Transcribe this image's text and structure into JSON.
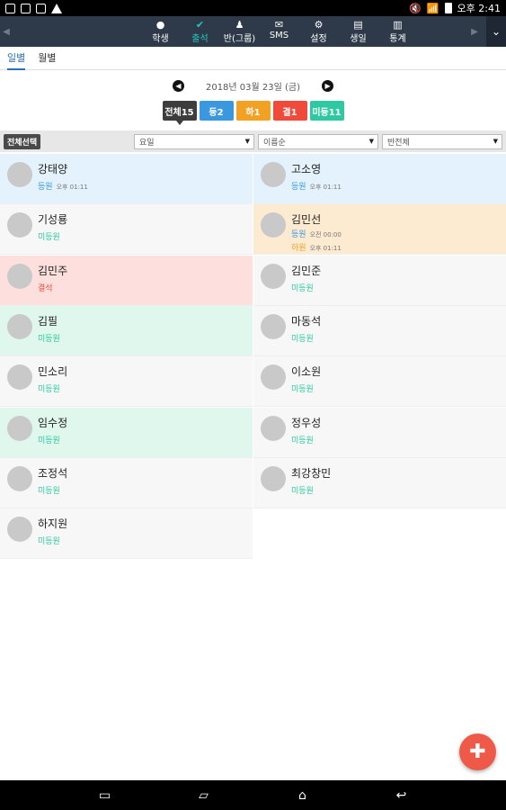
{
  "status_bar": {
    "time": "오후 2:41",
    "left_icons": [
      "image-icon",
      "wifi-calling-icon",
      "gallery-icon",
      "warning-icon"
    ],
    "right_icons": [
      "mute-icon",
      "wifi-icon",
      "battery-icon"
    ]
  },
  "top_nav": {
    "items": [
      {
        "label": "학생",
        "icon": "person-icon",
        "active": false
      },
      {
        "label": "출석",
        "icon": "check-circle-icon",
        "active": true
      },
      {
        "label": "반(그룹)",
        "icon": "group-icon",
        "active": false
      },
      {
        "label": "SMS",
        "icon": "mail-icon",
        "active": false
      },
      {
        "label": "설정",
        "icon": "gear-icon",
        "active": false
      },
      {
        "label": "생일",
        "icon": "cake-icon",
        "active": false
      },
      {
        "label": "통계",
        "icon": "chart-icon",
        "active": false
      }
    ]
  },
  "subtabs": [
    {
      "label": "일별",
      "active": true
    },
    {
      "label": "월별",
      "active": false
    }
  ],
  "date": {
    "text": "2018년 03월 23일 (금)"
  },
  "filters": {
    "all": "전체15",
    "in": "등2",
    "out": "하1",
    "absent": "결1",
    "none": "미등11"
  },
  "toolbar": {
    "select_all": "전체선택",
    "day_select": "요일",
    "sort_select": "이름순",
    "class_select": "반전체"
  },
  "students": [
    {
      "name": "강태양",
      "status1": "등원",
      "time1": "오후 01:11",
      "status2": "",
      "time2": "",
      "bg": "blue"
    },
    {
      "name": "고소영",
      "status1": "등원",
      "time1": "오후 01:11",
      "status2": "",
      "time2": "",
      "bg": "blue"
    },
    {
      "name": "기성룡",
      "status1": "미등원",
      "time1": "",
      "status2": "",
      "time2": "",
      "bg": "gray"
    },
    {
      "name": "김민선",
      "status1": "등원",
      "time1": "오전 00:00",
      "status2": "하원",
      "time2": "오후 01:11",
      "bg": "orange"
    },
    {
      "name": "김민주",
      "status1": "결석",
      "time1": "",
      "status2": "",
      "time2": "",
      "bg": "pink"
    },
    {
      "name": "김민준",
      "status1": "미등원",
      "time1": "",
      "status2": "",
      "time2": "",
      "bg": "gray"
    },
    {
      "name": "김필",
      "status1": "미등원",
      "time1": "",
      "status2": "",
      "time2": "",
      "bg": "green"
    },
    {
      "name": "마동석",
      "status1": "미등원",
      "time1": "",
      "status2": "",
      "time2": "",
      "bg": "gray"
    },
    {
      "name": "민소리",
      "status1": "미등원",
      "time1": "",
      "status2": "",
      "time2": "",
      "bg": "gray"
    },
    {
      "name": "이소원",
      "status1": "미등원",
      "time1": "",
      "status2": "",
      "time2": "",
      "bg": "gray"
    },
    {
      "name": "임수정",
      "status1": "미등원",
      "time1": "",
      "status2": "",
      "time2": "",
      "bg": "green"
    },
    {
      "name": "정우성",
      "status1": "미등원",
      "time1": "",
      "status2": "",
      "time2": "",
      "bg": "gray"
    },
    {
      "name": "조정석",
      "status1": "미등원",
      "time1": "",
      "status2": "",
      "time2": "",
      "bg": "gray"
    },
    {
      "name": "최강창민",
      "status1": "미등원",
      "time1": "",
      "status2": "",
      "time2": "",
      "bg": "gray"
    },
    {
      "name": "하지원",
      "status1": "미등원",
      "time1": "",
      "status2": "",
      "time2": "",
      "bg": "gray"
    }
  ],
  "colors": {
    "nav_bg": "#2e3a4a",
    "accent": "#24c6c0",
    "in": "#3c98de",
    "out": "#f2a123",
    "absent": "#ef4a3a",
    "none": "#2ec9a0",
    "fab": "#ef5a48"
  },
  "fab": {
    "icon": "add-icon"
  }
}
